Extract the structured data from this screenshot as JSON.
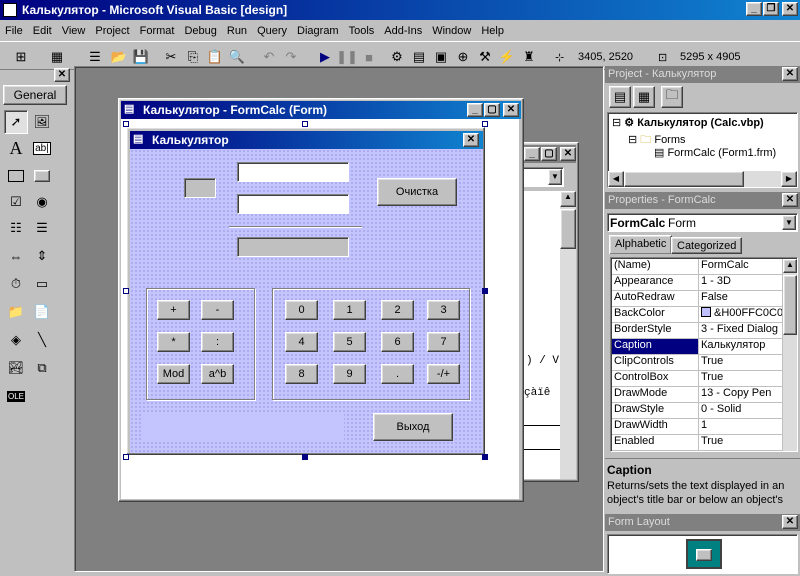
{
  "app": {
    "title": "Калькулятор - Microsoft Visual Basic [design]"
  },
  "menu": [
    "File",
    "Edit",
    "View",
    "Project",
    "Format",
    "Debug",
    "Run",
    "Query",
    "Diagram",
    "Tools",
    "Add-Ins",
    "Window",
    "Help"
  ],
  "toolbar": {
    "pos": "3405, 2520",
    "size": "5295 x 4905"
  },
  "toolbox": {
    "title": "General"
  },
  "form_window": {
    "title": "Калькулятор - FormCalc (Form)"
  },
  "form": {
    "title": "Калькулятор",
    "clear_button": "Очистка",
    "exit_button": "Выход",
    "ops": [
      "+",
      "-",
      "*",
      ":",
      "Mod",
      "a^b"
    ],
    "digits": [
      "0",
      "1",
      "2",
      "3",
      "4",
      "5",
      "6",
      "7",
      "8",
      "9",
      ".",
      "-/+"
    ]
  },
  "code_window": {
    "fragments": [
      ") / V",
      "çàïê"
    ]
  },
  "project": {
    "title": "Project - Калькулятор",
    "root": "Калькулятор (Calc.vbp)",
    "folder": "Forms",
    "item": "FormCalc (Form1.frm)"
  },
  "properties": {
    "title": "Properties - FormCalc",
    "object": "FormCalc",
    "object_type": "Form",
    "tabs": [
      "Alphabetic",
      "Categorized"
    ],
    "rows": [
      {
        "k": "(Name)",
        "v": "FormCalc"
      },
      {
        "k": "Appearance",
        "v": "1 - 3D"
      },
      {
        "k": "AutoRedraw",
        "v": "False"
      },
      {
        "k": "BackColor",
        "v": "&H00FFC0C0"
      },
      {
        "k": "BorderStyle",
        "v": "3 - Fixed Dialog"
      },
      {
        "k": "Caption",
        "v": "Калькулятор"
      },
      {
        "k": "ClipControls",
        "v": "True"
      },
      {
        "k": "ControlBox",
        "v": "True"
      },
      {
        "k": "DrawMode",
        "v": "13 - Copy Pen"
      },
      {
        "k": "DrawStyle",
        "v": "0 - Solid"
      },
      {
        "k": "DrawWidth",
        "v": "1"
      },
      {
        "k": "Enabled",
        "v": "True"
      }
    ],
    "desc_title": "Caption",
    "desc_text": "Returns/sets the text displayed in an object's title bar or below an object's"
  },
  "layout": {
    "title": "Form Layout"
  },
  "colors": {
    "titlebar": "#000080",
    "form_back": "#c4c4ff",
    "selection": "#000080"
  }
}
